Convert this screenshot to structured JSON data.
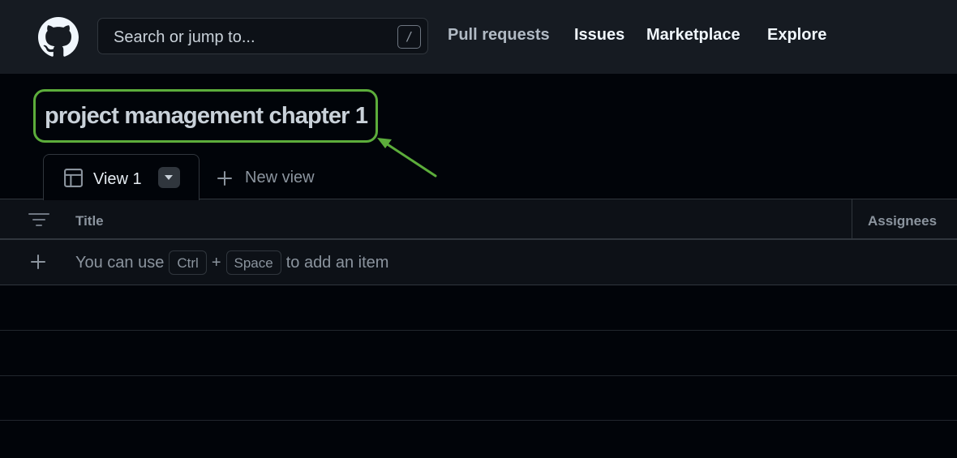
{
  "header": {
    "logo_icon": "github-mark-icon",
    "search": {
      "placeholder": "Search or jump to...",
      "shortcut": "/"
    },
    "nav": [
      {
        "label": "Pull requests"
      },
      {
        "label": "Issues"
      },
      {
        "label": "Marketplace"
      },
      {
        "label": "Explore"
      }
    ]
  },
  "project": {
    "title": "project management chapter 1",
    "highlight_color": "#5cad3b"
  },
  "tabs": {
    "active": {
      "label": "View 1",
      "icon": "table-icon"
    },
    "new_view": {
      "label": "New view",
      "icon": "plus-icon"
    }
  },
  "table": {
    "columns": [
      {
        "label": "Title"
      },
      {
        "label": "Assignees"
      }
    ],
    "add_item": {
      "prefix": "You can use",
      "key1": "Ctrl",
      "joiner": "+",
      "key2": "Space",
      "suffix": "to add an item"
    }
  }
}
